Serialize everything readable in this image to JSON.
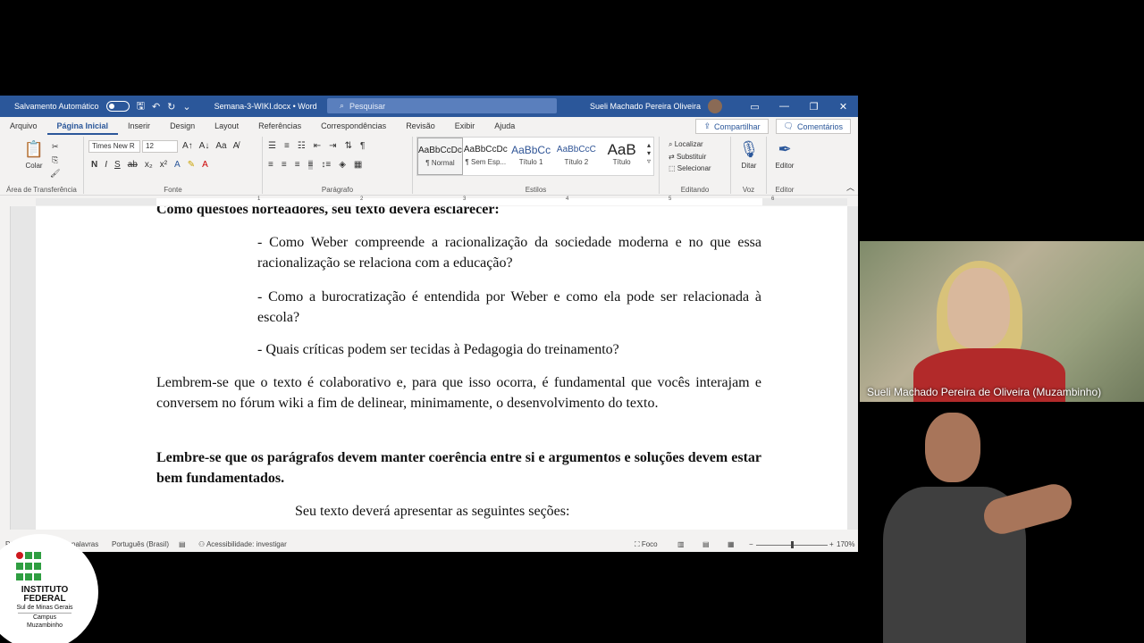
{
  "titlebar": {
    "autosave_label": "Salvamento Automático",
    "doc_title": "Semana-3-WIKI.docx  •  Word",
    "search_placeholder": "Pesquisar",
    "user_name": "Sueli Machado Pereira Oliveira"
  },
  "tabs": [
    "Arquivo",
    "Página Inicial",
    "Inserir",
    "Design",
    "Layout",
    "Referências",
    "Correspondências",
    "Revisão",
    "Exibir",
    "Ajuda"
  ],
  "share_label": "Compartilhar",
  "comments_label": "Comentários",
  "ribbon": {
    "clipboard_label": "Área de Transferência",
    "paste_label": "Colar",
    "font_label": "Fonte",
    "font_name": "Times New R",
    "font_size": "12",
    "paragraph_label": "Parágrafo",
    "styles_label": "Estilos",
    "styles": [
      {
        "preview": "AaBbCcDc",
        "name": "¶ Normal"
      },
      {
        "preview": "AaBbCcDc",
        "name": "¶ Sem Esp..."
      },
      {
        "preview": "AaBbCc",
        "name": "Título 1"
      },
      {
        "preview": "AaBbCcC",
        "name": "Título 2"
      },
      {
        "preview": "AaB",
        "name": "Título"
      }
    ],
    "find_label": "Localizar",
    "replace_label": "Substituir",
    "select_label": "Selecionar",
    "editing_label": "Editando",
    "dictate_label": "Ditar",
    "voice_label": "Voz",
    "editor_label": "Editor",
    "editor_group_label": "Editor"
  },
  "document": {
    "heading": "Como questões norteadores, seu texto deverá esclarecer:",
    "q1": "- Como Weber compreende a racionalização da sociedade moderna e no que essa racionalização se relaciona com a educação?",
    "q2": "- Como a burocratização é entendida por Weber e como ela pode ser relacionada à escola?",
    "q3": "- Quais críticas podem ser tecidas à Pedagogia do treinamento?",
    "p1": "Lembrem-se que o texto é colaborativo e, para que isso ocorra, é fundamental que vocês interajam e conversem no fórum wiki a fim de delinear, minimamente, o desenvolvimento do texto.",
    "p2": "Lembre-se que os parágrafos devem manter coerência entre si e argumentos e soluções devem estar bem fundamentados.",
    "p3": "Seu texto deverá apresentar as seguintes seções:"
  },
  "statusbar": {
    "page": "Pá",
    "words": "palavras",
    "language": "Português (Brasil)",
    "accessibility": "Acessibilidade: investigar",
    "focus": "Foco",
    "zoom": "170%"
  },
  "video": {
    "presenter_name": "Sueli Machado Pereira de Oliveira (Muzambinho)"
  },
  "logo": {
    "line1": "INSTITUTO",
    "line2": "FEDERAL",
    "line3": "Sul de Minas Gerais",
    "line4": "Campus",
    "line5": "Muzambinho"
  },
  "colors": {
    "word_blue": "#2b579a",
    "if_green": "#2f9e41",
    "if_red": "#cd191e"
  }
}
